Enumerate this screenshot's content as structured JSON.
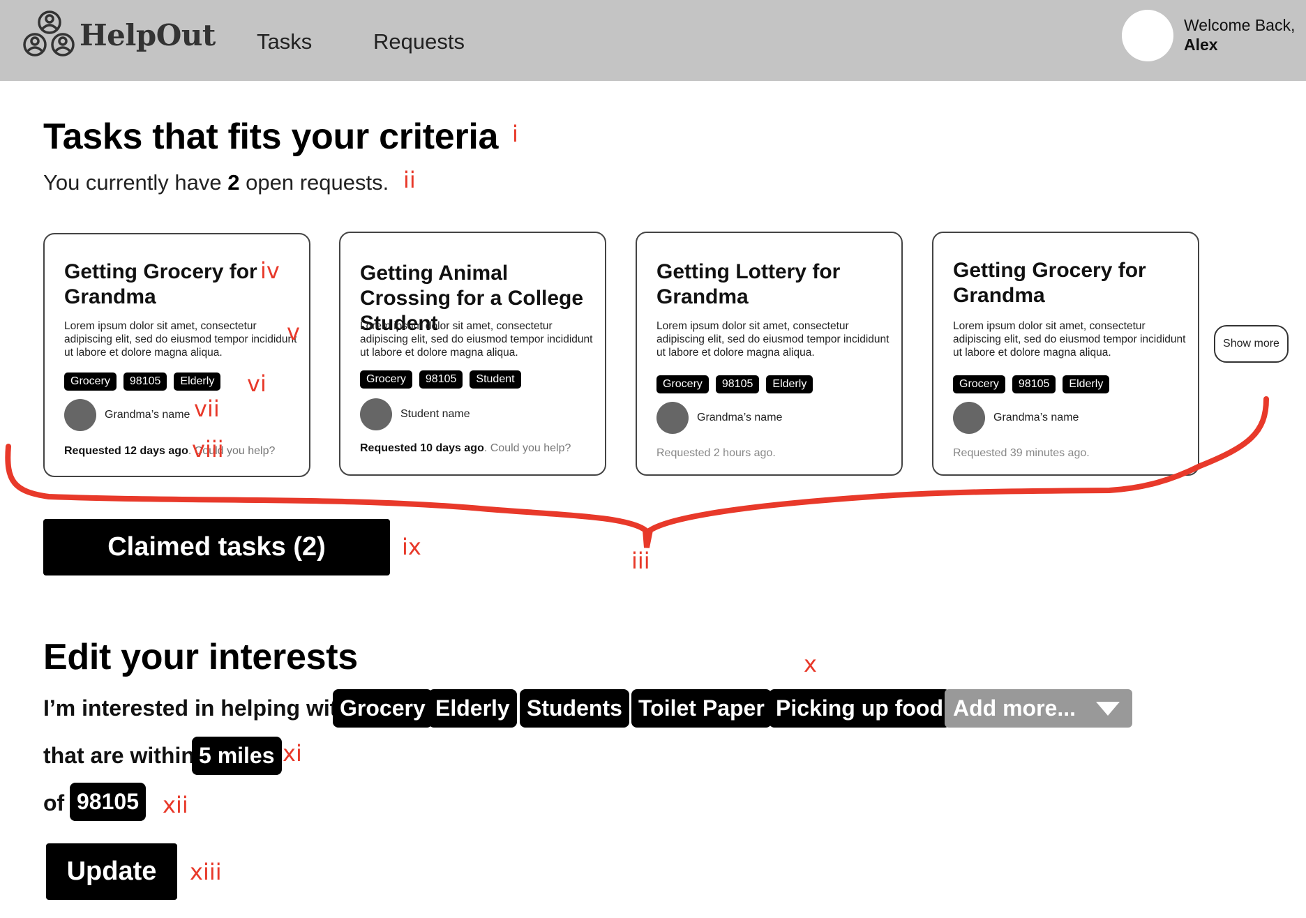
{
  "header": {
    "logo_text": "HelpOut",
    "nav": [
      "Tasks",
      "Requests"
    ],
    "welcome_line": "Welcome Back,",
    "user_name": "Alex"
  },
  "criteria": {
    "title": "Tasks that fits your criteria",
    "subtitle_pre": "You currently have",
    "open_count": "2",
    "subtitle_post": "open requests."
  },
  "cards": [
    {
      "title": "Getting Grocery for Grandma",
      "desc": "Lorem ipsum dolor sit amet, consectetur adipiscing elit, sed do eiusmod tempor incididunt ut labore et dolore magna aliqua.",
      "tags": [
        "Grocery",
        "98105",
        "Elderly"
      ],
      "person": "Grandma’s name",
      "requested": "Requested 12 days ago",
      "help": ". Could you help?"
    },
    {
      "title": "Getting Animal Crossing for a College Student",
      "desc": "Lorem ipsum dolor sit amet, consectetur adipiscing elit, sed do eiusmod tempor incididunt ut labore et dolore magna aliqua.",
      "tags": [
        "Grocery",
        "98105",
        "Student"
      ],
      "person": "Student name",
      "requested": "Requested 10 days ago",
      "help": ". Could you help?"
    },
    {
      "title": "Getting Lottery for Grandma",
      "desc": "Lorem ipsum dolor sit amet, consectetur adipiscing elit, sed do eiusmod tempor incididunt ut labore et dolore magna aliqua.",
      "tags": [
        "Grocery",
        "98105",
        "Elderly"
      ],
      "person": "Grandma’s name",
      "requested": "Requested 2 hours ago."
    },
    {
      "title": "Getting Grocery for Grandma",
      "desc": "Lorem ipsum dolor sit amet, consectetur adipiscing elit, sed do eiusmod tempor incididunt ut labore et dolore magna aliqua.",
      "tags": [
        "Grocery",
        "98105",
        "Elderly"
      ],
      "person": "Grandma’s name",
      "requested": "Requested 39 minutes ago."
    }
  ],
  "show_more": "Show more",
  "claimed_button": "Claimed tasks (2)",
  "interests": {
    "title": "Edit your interests",
    "lead": "I’m interested in helping with",
    "chips": [
      "Grocery",
      "Elderly",
      "Students",
      "Toilet Paper",
      "Picking up food"
    ],
    "add_more": "Add more...",
    "within": "that are within",
    "distance": "5 miles",
    "of": "of",
    "zip": "98105",
    "update": "Update"
  },
  "annotations": [
    "i",
    "ii",
    "iii",
    "iv",
    "v",
    "vi",
    "vii",
    "viii",
    "ix",
    "x",
    "xi",
    "xii",
    "xiii"
  ],
  "colors": {
    "header_bg": "#c4c4c4",
    "annotation": "#e8392a",
    "chip": "#000000",
    "add_more": "#999999"
  }
}
